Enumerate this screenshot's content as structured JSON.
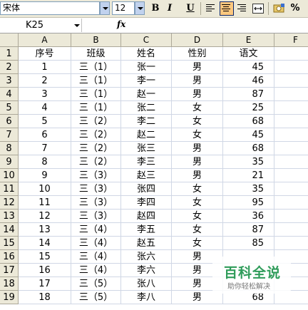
{
  "toolbar": {
    "font_name": "宋体",
    "font_size": "12",
    "bold_label": "B",
    "italic_label": "I",
    "underline_label": "U"
  },
  "formula_bar": {
    "name_box": "K25",
    "fx_label": "fx"
  },
  "columns": [
    "A",
    "B",
    "C",
    "D",
    "E",
    "F"
  ],
  "rows": [
    {
      "num": "1",
      "a": "序号",
      "b": "班级",
      "c": "姓名",
      "d": "性别",
      "e": "语文"
    },
    {
      "num": "2",
      "a": "1",
      "b": "三（1）",
      "c": "张一",
      "d": "男",
      "e": "45"
    },
    {
      "num": "3",
      "a": "2",
      "b": "三（1）",
      "c": "李一",
      "d": "男",
      "e": "46"
    },
    {
      "num": "4",
      "a": "3",
      "b": "三（1）",
      "c": "赵一",
      "d": "男",
      "e": "87"
    },
    {
      "num": "5",
      "a": "4",
      "b": "三（1）",
      "c": "张二",
      "d": "女",
      "e": "25"
    },
    {
      "num": "6",
      "a": "5",
      "b": "三（2）",
      "c": "李二",
      "d": "女",
      "e": "68"
    },
    {
      "num": "7",
      "a": "6",
      "b": "三（2）",
      "c": "赵二",
      "d": "女",
      "e": "45"
    },
    {
      "num": "8",
      "a": "7",
      "b": "三（2）",
      "c": "张三",
      "d": "男",
      "e": "68"
    },
    {
      "num": "9",
      "a": "8",
      "b": "三（2）",
      "c": "李三",
      "d": "男",
      "e": "35"
    },
    {
      "num": "10",
      "a": "9",
      "b": "三（3）",
      "c": "赵三",
      "d": "男",
      "e": "21"
    },
    {
      "num": "11",
      "a": "10",
      "b": "三（3）",
      "c": "张四",
      "d": "女",
      "e": "35"
    },
    {
      "num": "12",
      "a": "11",
      "b": "三（3）",
      "c": "李四",
      "d": "女",
      "e": "95"
    },
    {
      "num": "13",
      "a": "12",
      "b": "三（3）",
      "c": "赵四",
      "d": "女",
      "e": "36"
    },
    {
      "num": "14",
      "a": "13",
      "b": "三（4）",
      "c": "李五",
      "d": "女",
      "e": "87"
    },
    {
      "num": "15",
      "a": "14",
      "b": "三（4）",
      "c": "赵五",
      "d": "女",
      "e": "85"
    },
    {
      "num": "16",
      "a": "15",
      "b": "三（4）",
      "c": "张六",
      "d": "男",
      "e": ""
    },
    {
      "num": "17",
      "a": "16",
      "b": "三（4）",
      "c": "李六",
      "d": "男",
      "e": ""
    },
    {
      "num": "18",
      "a": "17",
      "b": "三（5）",
      "c": "张八",
      "d": "男",
      "e": ""
    },
    {
      "num": "19",
      "a": "18",
      "b": "三（5）",
      "c": "李八",
      "d": "男",
      "e": "68"
    }
  ],
  "watermark": {
    "title": "百科全说",
    "subtitle": "助你轻松解决"
  }
}
